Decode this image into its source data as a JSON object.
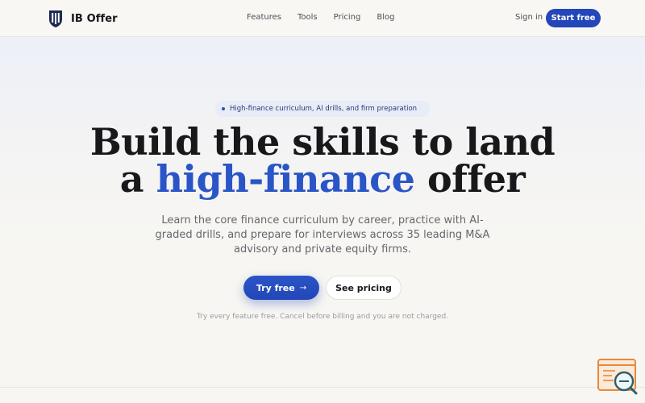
{
  "brand": {
    "name": "IB Offer",
    "logo_icon": "shield-pillars-icon"
  },
  "nav": {
    "links": [
      {
        "label": "Features"
      },
      {
        "label": "Tools"
      },
      {
        "label": "Pricing"
      },
      {
        "label": "Blog"
      }
    ],
    "signin_label": "Sign in",
    "start_label": "Start free"
  },
  "hero": {
    "pill_text": "High-finance curriculum, AI drills, and firm preparation",
    "headline_line1": "Build the skills to land",
    "headline_line2_prefix": "a ",
    "headline_accent": "high-finance",
    "headline_line2_suffix": " offer",
    "subtext": "Learn the core finance curriculum by career, practice with AI-graded drills, and prepare for interviews across 35 leading M&A advisory and private equity firms.",
    "cta_primary": "Try free",
    "cta_primary_icon": "arrow-right-icon",
    "cta_secondary": "See pricing",
    "note": "Try every feature free. Cancel before billing and you are not charged."
  },
  "widget": {
    "icon": "browser-search-icon"
  },
  "colors": {
    "accent": "#2a55c7",
    "button": "#2346b8",
    "text": "#18181b",
    "background": "#f7f6f2",
    "widget": "#e8893c"
  }
}
